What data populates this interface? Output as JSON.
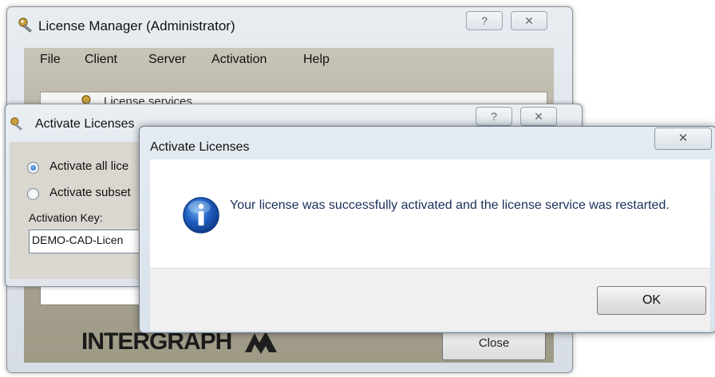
{
  "license_manager": {
    "title": "License Manager (Administrator)",
    "help_glyph": "?",
    "close_glyph": "✕",
    "menu": [
      "File",
      "Client",
      "Server",
      "Activation",
      "Help"
    ],
    "tree_item": "License services",
    "logo_text": "INTERGRAPH",
    "close_button_label": "Close"
  },
  "activate_licenses": {
    "title": "Activate Licenses",
    "help_glyph": "?",
    "close_glyph": "✕",
    "option_all": "Activate all lice",
    "option_subset": "Activate subset",
    "key_label": "Activation Key:",
    "key_value": "DEMO-CAD-Licen",
    "option_all_selected": true
  },
  "message_box": {
    "title": "Activate Licenses",
    "close_glyph": "✕",
    "icon": "info-icon",
    "message": "Your license was successfully activated and the license service was restarted.",
    "ok_label": "OK"
  },
  "colors": {
    "info_blue": "#1f5fc2",
    "message_text": "#1a2f5a"
  }
}
